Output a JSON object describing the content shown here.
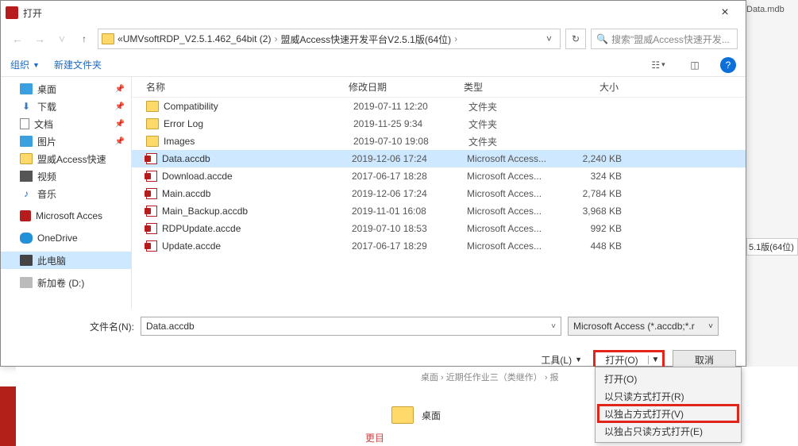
{
  "bg": {
    "topfile": "Data.mdb",
    "midfile": "5.1版(64位)"
  },
  "dialog": {
    "title": "打开",
    "breadcrumb": {
      "prefix": "«",
      "seg1": "UMVsoftRDP_V2.5.1.462_64bit (2)",
      "seg2": "盟威Access快速开发平台V2.5.1版(64位)"
    },
    "search_placeholder": "搜索\"盟威Access快速开发...",
    "toolbar": {
      "organize": "组织",
      "newfolder": "新建文件夹"
    },
    "sidebar": [
      {
        "icon": "desktop",
        "label": "桌面",
        "pinned": true
      },
      {
        "icon": "download",
        "label": "下载",
        "pinned": true
      },
      {
        "icon": "doc",
        "label": "文档",
        "pinned": true
      },
      {
        "icon": "pic",
        "label": "图片",
        "pinned": true
      },
      {
        "icon": "fld",
        "label": "盟威Access快速",
        "pinned": false
      },
      {
        "icon": "video",
        "label": "视频",
        "pinned": false
      },
      {
        "icon": "music",
        "label": "音乐",
        "pinned": false
      },
      {
        "icon": "spacer"
      },
      {
        "icon": "access",
        "label": "Microsoft Acces",
        "pinned": false
      },
      {
        "icon": "spacer"
      },
      {
        "icon": "cloud",
        "label": "OneDrive",
        "pinned": false
      },
      {
        "icon": "spacer"
      },
      {
        "icon": "pc",
        "label": "此电脑",
        "pinned": false,
        "selected": true
      },
      {
        "icon": "spacer"
      },
      {
        "icon": "drive",
        "label": "新加卷 (D:)",
        "pinned": false
      }
    ],
    "columns": {
      "name": "名称",
      "date": "修改日期",
      "type": "类型",
      "size": "大小"
    },
    "files": [
      {
        "ico": "folder",
        "name": "Compatibility",
        "date": "2019-07-11 12:20",
        "type": "文件夹",
        "size": ""
      },
      {
        "ico": "folder",
        "name": "Error Log",
        "date": "2019-11-25 9:34",
        "type": "文件夹",
        "size": ""
      },
      {
        "ico": "folder",
        "name": "Images",
        "date": "2019-07-10 19:08",
        "type": "文件夹",
        "size": ""
      },
      {
        "ico": "accdb",
        "name": "Data.accdb",
        "date": "2019-12-06 17:24",
        "type": "Microsoft Access...",
        "size": "2,240 KB",
        "selected": true
      },
      {
        "ico": "accdb",
        "name": "Download.accde",
        "date": "2017-06-17 18:28",
        "type": "Microsoft Acces...",
        "size": "324 KB"
      },
      {
        "ico": "accdb",
        "name": "Main.accdb",
        "date": "2019-12-06 17:24",
        "type": "Microsoft Acces...",
        "size": "2,784 KB"
      },
      {
        "ico": "accdb",
        "name": "Main_Backup.accdb",
        "date": "2019-11-01 16:08",
        "type": "Microsoft Acces...",
        "size": "3,968 KB"
      },
      {
        "ico": "accdb",
        "name": "RDPUpdate.accde",
        "date": "2019-07-10 18:53",
        "type": "Microsoft Acces...",
        "size": "992 KB"
      },
      {
        "ico": "accdb",
        "name": "Update.accde",
        "date": "2017-06-17 18:29",
        "type": "Microsoft Acces...",
        "size": "448 KB"
      }
    ],
    "filename_label": "文件名(N):",
    "filename_value": "Data.accdb",
    "filetype": "Microsoft Access (*.accdb;*.r",
    "tools_label": "工具(L)",
    "open_label": "打开(O)",
    "cancel_label": "取消"
  },
  "under": {
    "crumbs": "桌面 › 近期任作业三（类继作） › 报",
    "desktop": "桌面",
    "red": "更目"
  },
  "menu": {
    "items": [
      {
        "label": "打开(O)"
      },
      {
        "label": "以只读方式打开(R)"
      },
      {
        "label": "以独占方式打开(V)",
        "hl": true
      },
      {
        "label": "以独占只读方式打开(E)"
      }
    ]
  }
}
